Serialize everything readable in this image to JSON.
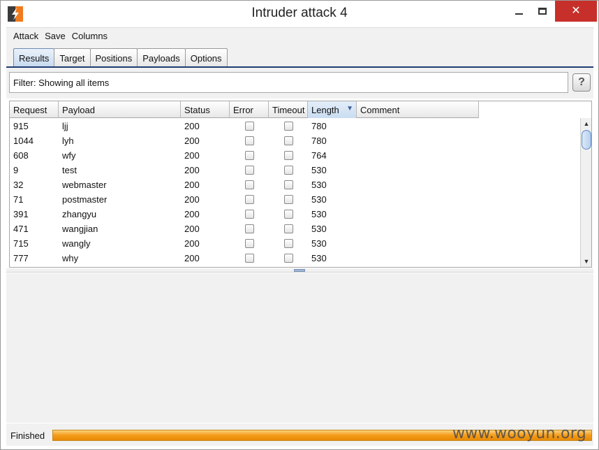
{
  "window": {
    "title": "Intruder attack 4",
    "minimize_icon": "minimize-icon",
    "maximize_icon": "maximize-icon",
    "close_icon": "close-icon",
    "close_symbol": "✕"
  },
  "menu": [
    "Attack",
    "Save",
    "Columns"
  ],
  "tabs": [
    "Results",
    "Target",
    "Positions",
    "Payloads",
    "Options"
  ],
  "active_tab": "Results",
  "filter": {
    "text": "Filter: Showing all items",
    "help_label": "?"
  },
  "table": {
    "columns": [
      "Request",
      "Payload",
      "Status",
      "Error",
      "Timeout",
      "Length",
      "Comment"
    ],
    "sorted_column": "Length",
    "rows": [
      {
        "request": "915",
        "payload": "ljj",
        "status": "200",
        "error": false,
        "timeout": false,
        "length": "780",
        "comment": ""
      },
      {
        "request": "1044",
        "payload": "lyh",
        "status": "200",
        "error": false,
        "timeout": false,
        "length": "780",
        "comment": ""
      },
      {
        "request": "608",
        "payload": "wfy",
        "status": "200",
        "error": false,
        "timeout": false,
        "length": "764",
        "comment": ""
      },
      {
        "request": "9",
        "payload": "test",
        "status": "200",
        "error": false,
        "timeout": false,
        "length": "530",
        "comment": ""
      },
      {
        "request": "32",
        "payload": "webmaster",
        "status": "200",
        "error": false,
        "timeout": false,
        "length": "530",
        "comment": ""
      },
      {
        "request": "71",
        "payload": "postmaster",
        "status": "200",
        "error": false,
        "timeout": false,
        "length": "530",
        "comment": ""
      },
      {
        "request": "391",
        "payload": "zhangyu",
        "status": "200",
        "error": false,
        "timeout": false,
        "length": "530",
        "comment": ""
      },
      {
        "request": "471",
        "payload": "wangjian",
        "status": "200",
        "error": false,
        "timeout": false,
        "length": "530",
        "comment": ""
      },
      {
        "request": "715",
        "payload": "wangly",
        "status": "200",
        "error": false,
        "timeout": false,
        "length": "530",
        "comment": ""
      },
      {
        "request": "777",
        "payload": "why",
        "status": "200",
        "error": false,
        "timeout": false,
        "length": "530",
        "comment": ""
      }
    ]
  },
  "status": {
    "text": "Finished",
    "progress": 1.0,
    "watermark": "www.wooyun.org"
  },
  "colors": {
    "accent": "#1f3d72",
    "progress": "#f39b19",
    "close_button": "#c7302a"
  }
}
